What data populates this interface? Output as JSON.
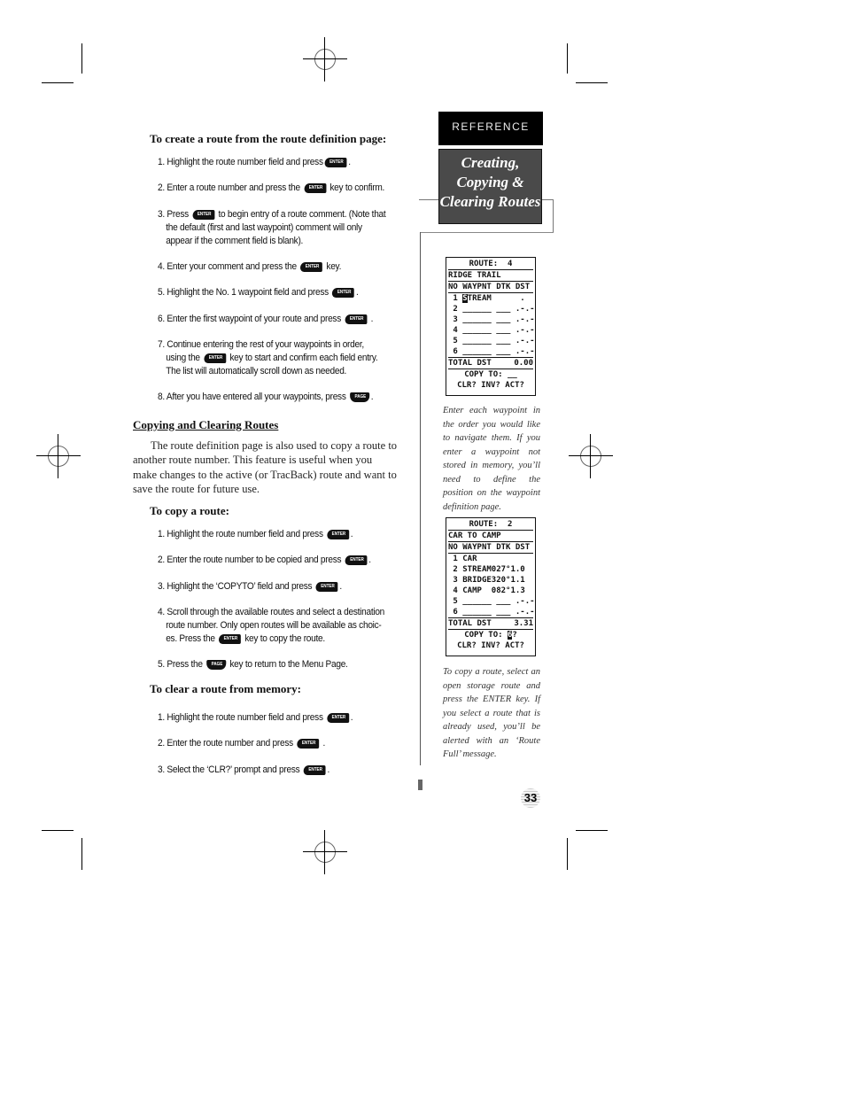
{
  "sidebar": {
    "section_tab": "REFERENCE",
    "title_lines": [
      "Creating,",
      "Copying &",
      "Clearing Routes"
    ]
  },
  "create_route": {
    "heading": "To create a route from the route definition page:",
    "steps": [
      {
        "pre": "1. Highlight the route number field and press",
        "key": "ENTER",
        "post": "."
      },
      {
        "pre": "2. Enter a route number and press the",
        "key": "ENTER",
        "post": "key to confirm."
      },
      {
        "pre": "3. Press",
        "key": "ENTER",
        "post": "to begin entry of a route comment. (Note that",
        "cont": [
          "the default (first and last waypoint) comment will only",
          "appear if the comment field is blank)."
        ]
      },
      {
        "pre": "4. Enter your comment and press the",
        "key": "ENTER",
        "post": "key."
      },
      {
        "pre": "5. Highlight the No. 1 waypoint field and press",
        "key": "ENTER",
        "post": "."
      },
      {
        "pre": "6. Enter the first waypoint of your route and press",
        "key": "ENTER",
        "post": "."
      },
      {
        "pre": "7. Continue entering the rest of your waypoints in order,",
        "cont_pre": "using the",
        "key": "ENTER",
        "cont_post": "key to start and confirm each field entry.",
        "cont": [
          "The list will automatically scroll down as needed."
        ]
      },
      {
        "pre": "8. After you have entered all your waypoints, press",
        "key": "PAGE",
        "post": "."
      }
    ]
  },
  "copy_clear": {
    "section_heading": "Copying and Clearing Routes",
    "paragraph_lines": [
      "The route definition page is also used to copy a route to",
      "another route number. This feature is useful when you",
      "make changes to the active (or TracBack) route and want to",
      "save the route for future use."
    ],
    "copy_heading": "To copy a route:",
    "copy_steps": [
      {
        "pre": "1. Highlight the route number field and press",
        "key": "ENTER",
        "post": "."
      },
      {
        "pre": "2. Enter the route number to be copied and press",
        "key": "ENTER",
        "post": "."
      },
      {
        "pre": "3. Highlight the ‘COPYTO’ field and press",
        "key": "ENTER",
        "post": "."
      },
      {
        "pre": "4. Scroll through the available routes and select a destination",
        "cont": [
          "route number. Only open routes will be available as choic-"
        ],
        "cont_pre": "es. Press the",
        "key": "ENTER",
        "cont_post": "key to copy the route."
      },
      {
        "pre": "5. Press the",
        "key": "PAGE",
        "post": "key to return to the Menu Page."
      }
    ],
    "clear_heading": "To clear a route from memory:",
    "clear_steps": [
      {
        "pre": "1. Highlight the route number field and press",
        "key": "ENTER",
        "post": "."
      },
      {
        "pre": "2. Enter the route number and press",
        "key": "ENTER",
        "post": "."
      },
      {
        "pre": "3. Select the ‘CLR?’ prompt and press",
        "key": "ENTER",
        "post": "."
      }
    ]
  },
  "screen1": {
    "title": "ROUTE:  4",
    "comment": "RIDGE TRAIL",
    "headers": [
      "NO",
      "WAYPNT",
      "DTK",
      "DST"
    ],
    "rows": [
      {
        "no": "1",
        "wpt_hl": "S",
        "wpt": "TREAM",
        "dtk": "   ",
        "dst": " .  "
      },
      {
        "no": "2",
        "wpt": "______",
        "dtk": "___",
        "dst": ".-.-"
      },
      {
        "no": "3",
        "wpt": "______",
        "dtk": "___",
        "dst": ".-.-"
      },
      {
        "no": "4",
        "wpt": "______",
        "dtk": "___",
        "dst": ".-.-"
      },
      {
        "no": "5",
        "wpt": "______",
        "dtk": "___",
        "dst": ".-.-"
      },
      {
        "no": "6",
        "wpt": "______",
        "dtk": "___",
        "dst": ".-.-"
      }
    ],
    "total_label": "TOTAL DST",
    "total_value": "0.00",
    "copy_to_label": "COPY TO:",
    "copy_to_value": "__",
    "prompts": "CLR? INV? ACT?"
  },
  "screen2": {
    "title": "ROUTE:  2",
    "comment": "CAR TO CAMP",
    "headers": [
      "NO",
      "WAYPNT",
      "DTK",
      "DST"
    ],
    "rows": [
      {
        "no": "1",
        "wpt": "CAR",
        "dtk": "",
        "dst": ""
      },
      {
        "no": "2",
        "wpt": "STREAM",
        "dtk": "027°",
        "dst": "1.0"
      },
      {
        "no": "3",
        "wpt": "BRIDGE",
        "dtk": "320°",
        "dst": "1.1"
      },
      {
        "no": "4",
        "wpt": "CAMP",
        "dtk": "082°",
        "dst": "1.3"
      },
      {
        "no": "5",
        "wpt": "______",
        "dtk": "___",
        "dst": ".-.-"
      },
      {
        "no": "6",
        "wpt": "______",
        "dtk": "___",
        "dst": ".-.-"
      }
    ],
    "total_label": "TOTAL DST",
    "total_value": "3.31",
    "copy_to_label": "COPY TO:",
    "copy_to_value": "6",
    "copy_to_suffix": "?",
    "prompts": "CLR? INV? ACT?"
  },
  "captions": {
    "screen1": "Enter each waypoint in the order you would like to navigate them. If you enter a waypoint not stored in memory, you’ll need to define the position on the waypoint definition page.",
    "screen2": "To copy a route, select an open storage route and press the ENTER key. If you select a route that is already used, you’ll be alerted with an ‘Route Full’ message."
  },
  "page_number": "33"
}
